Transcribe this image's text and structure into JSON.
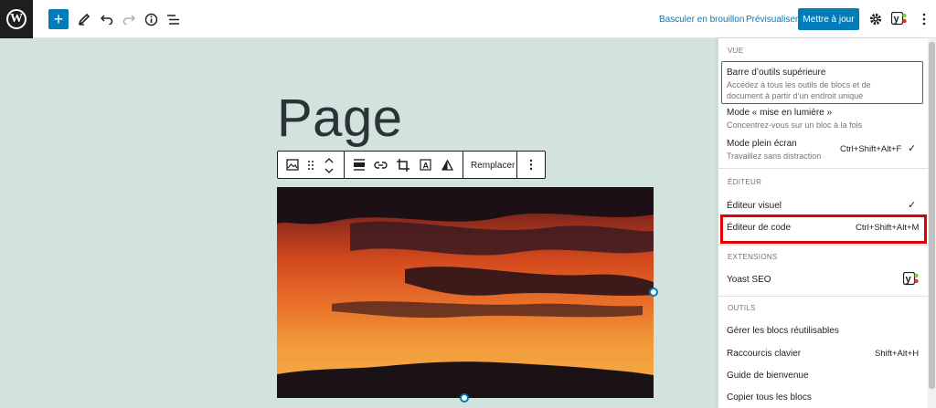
{
  "topbar": {
    "draft_label": "Basculer en brouillon",
    "preview_label": "Prévisualiser",
    "update_label": "Mettre à jour"
  },
  "editor": {
    "page_title": "Page",
    "replace_label": "Remplacer"
  },
  "panel": {
    "view_heading": "VUE",
    "top_toolbar_label": "Barre d’outils supérieure",
    "top_toolbar_desc_1": "Accédez à tous les outils de blocs et de",
    "top_toolbar_desc_2": "document à partir d’un endroit unique",
    "spotlight_label": "Mode « mise en lumière »",
    "spotlight_desc": "Concentrez-vous sur un bloc à la fois",
    "fullscreen_label": "Mode plein écran",
    "fullscreen_desc": "Travaillez sans distraction",
    "fullscreen_shortcut": "Ctrl+Shift+Alt+F",
    "editor_heading": "ÉDITEUR",
    "visual_editor_label": "Éditeur visuel",
    "code_editor_label": "Éditeur de code",
    "code_editor_shortcut": "Ctrl+Shift+Alt+M",
    "extensions_heading": "EXTENSIONS",
    "yoast_label": "Yoast SEO",
    "tools_heading": "OUTILS",
    "reusable_label": "Gérer les blocs réutilisables",
    "shortcuts_label": "Raccourcis clavier",
    "shortcuts_shortcut": "Shift+Alt+H",
    "welcome_label": "Guide de bienvenue",
    "copy_all_label": "Copier tous les blocs"
  },
  "colors": {
    "accent": "#007cba",
    "canvas": "#d2e3dd",
    "highlight": "#e00000"
  }
}
